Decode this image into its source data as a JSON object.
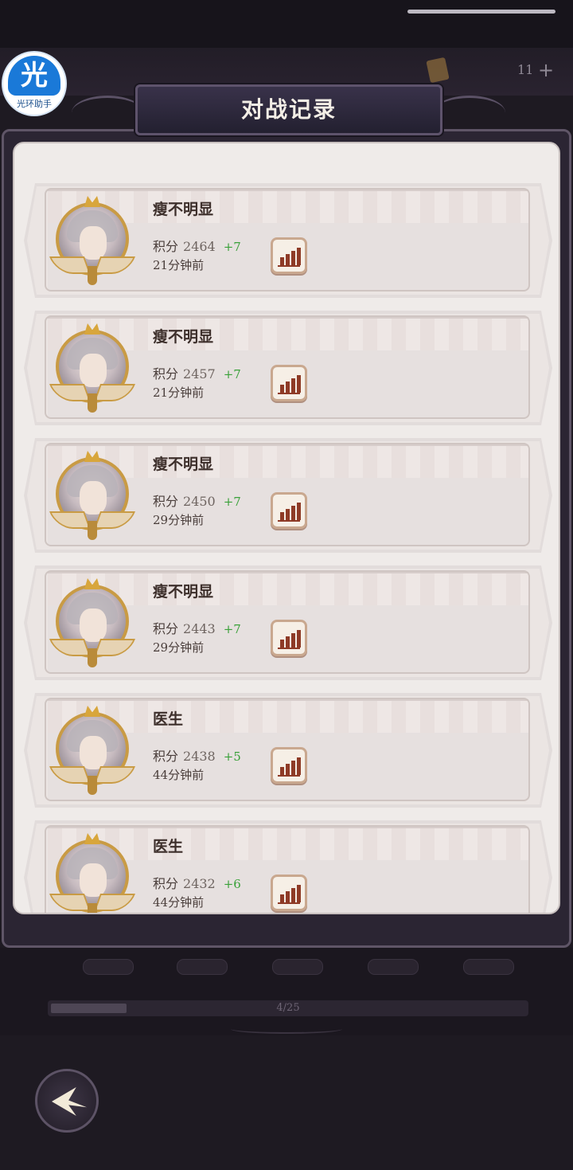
{
  "overlay": {
    "badge_char": "光",
    "badge_label": "光环助手"
  },
  "header": {
    "title": "对战记录"
  },
  "currency": {
    "count": "11",
    "plus": "+"
  },
  "records": [
    {
      "name": "瘦不明显",
      "score_label": "积分",
      "score": "2464",
      "delta": "+7",
      "time": "21分钟前"
    },
    {
      "name": "瘦不明显",
      "score_label": "积分",
      "score": "2457",
      "delta": "+7",
      "time": "21分钟前"
    },
    {
      "name": "瘦不明显",
      "score_label": "积分",
      "score": "2450",
      "delta": "+7",
      "time": "29分钟前"
    },
    {
      "name": "瘦不明显",
      "score_label": "积分",
      "score": "2443",
      "delta": "+7",
      "time": "29分钟前"
    },
    {
      "name": "医生",
      "score_label": "积分",
      "score": "2438",
      "delta": "+5",
      "time": "44分钟前"
    },
    {
      "name": "医生",
      "score_label": "积分",
      "score": "2432",
      "delta": "+6",
      "time": "44分钟前"
    }
  ],
  "footer": {
    "progress_text": "4/25",
    "progress_ratio": 0.16
  },
  "colors": {
    "delta_green": "#3aa13a",
    "panel_bg": "#efebe9",
    "accent_gold": "#c99b44"
  }
}
